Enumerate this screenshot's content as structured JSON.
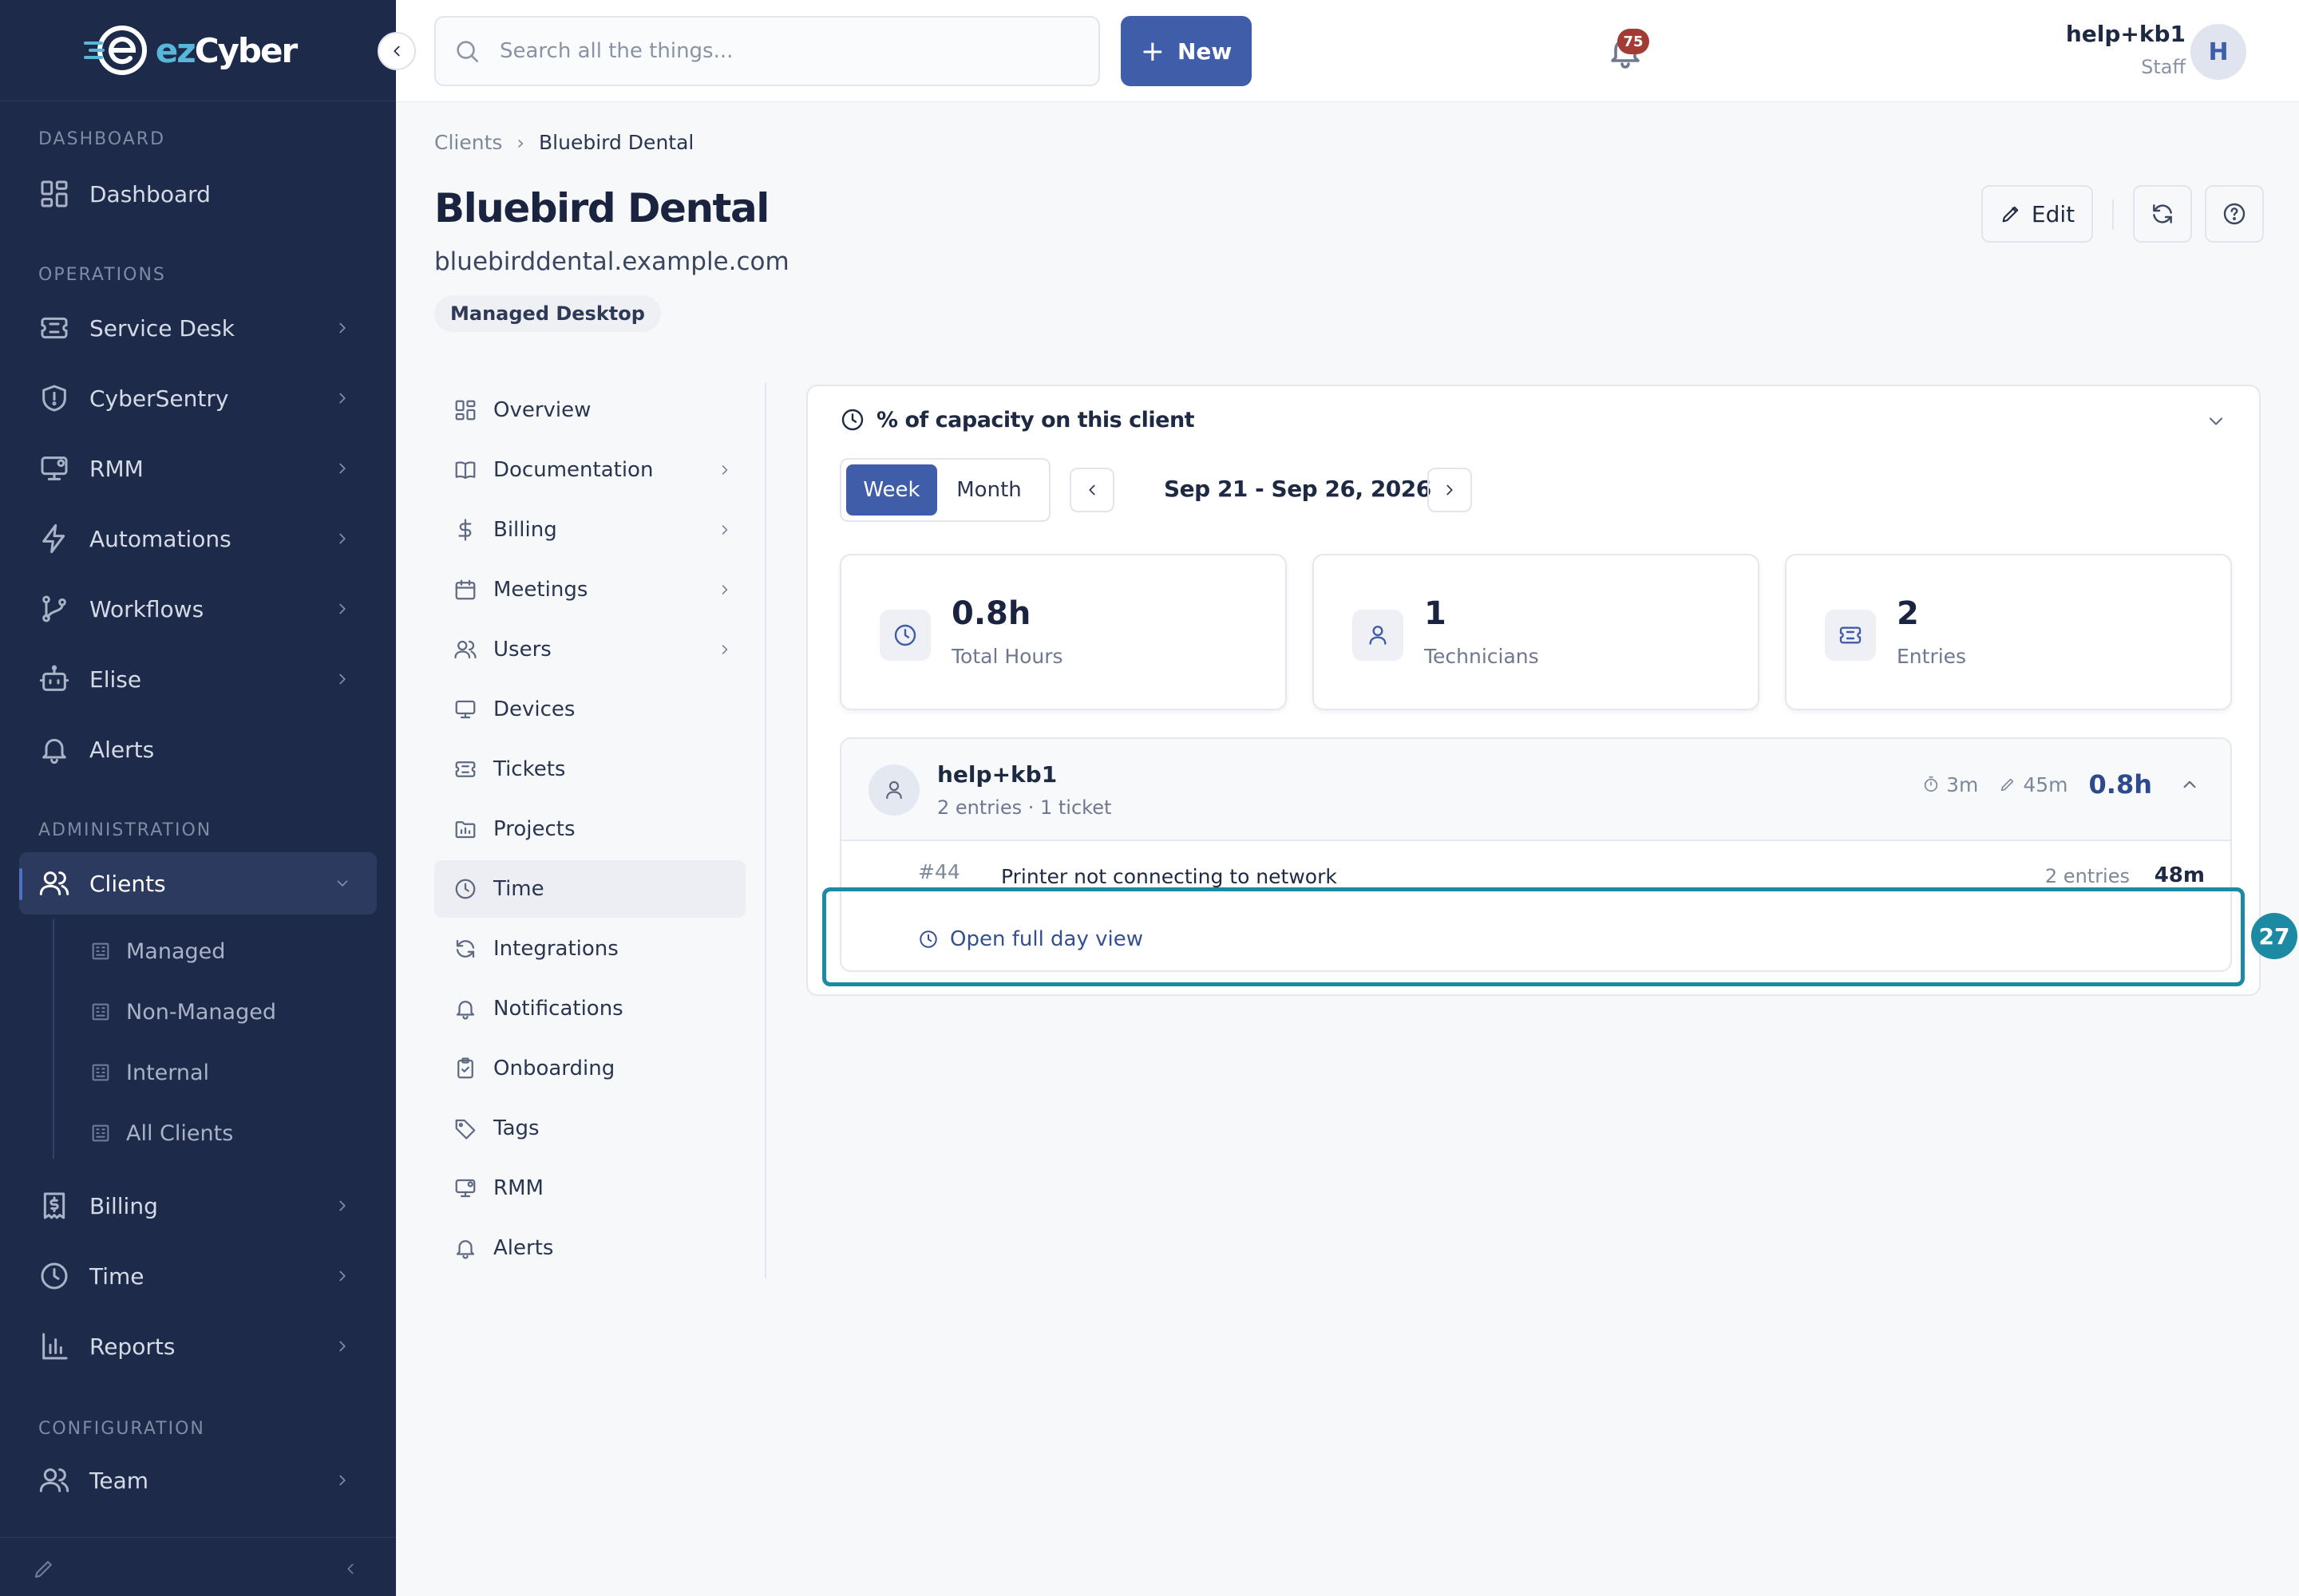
{
  "brand": {
    "name_prefix": "ez",
    "name_suffix": "Cyber"
  },
  "sidebar": {
    "sections": {
      "dashboard": "DASHBOARD",
      "operations": "OPERATIONS",
      "administration": "ADMINISTRATION",
      "configuration": "CONFIGURATION"
    },
    "items": {
      "dashboard": "Dashboard",
      "service_desk": "Service Desk",
      "cybersentry": "CyberSentry",
      "rmm": "RMM",
      "automations": "Automations",
      "workflows": "Workflows",
      "elise": "Elise",
      "alerts": "Alerts",
      "clients": "Clients",
      "billing": "Billing",
      "time": "Time",
      "reports": "Reports",
      "team": "Team"
    },
    "client_subitems": [
      "Managed",
      "Non-Managed",
      "Internal",
      "All Clients"
    ],
    "active_item": "Clients"
  },
  "topbar": {
    "search_placeholder": "Search all the things...",
    "new_label": "New",
    "notification_count": "75",
    "user_name": "help+kb1",
    "user_role": "Staff",
    "avatar_initial": "H"
  },
  "page": {
    "breadcrumb_root": "Clients",
    "breadcrumb_current": "Bluebird Dental",
    "title": "Bluebird Dental",
    "domain": "bluebirddental.example.com",
    "tag": "Managed Desktop",
    "edit_label": "Edit"
  },
  "subnav": {
    "items": [
      "Overview",
      "Documentation",
      "Billing",
      "Meetings",
      "Users",
      "Devices",
      "Tickets",
      "Projects",
      "Time",
      "Integrations",
      "Notifications",
      "Onboarding",
      "Tags",
      "RMM",
      "Alerts"
    ],
    "active": "Time"
  },
  "capacity": {
    "heading": "% of capacity on this client",
    "toggle": {
      "week": "Week",
      "month": "Month",
      "selected": "Week"
    },
    "date_range": "Sep 21 - Sep 26, 2026",
    "stats": [
      {
        "value": "0.8h",
        "label": "Total Hours",
        "icon": "clock-icon"
      },
      {
        "value": "1",
        "label": "Technicians",
        "icon": "user-icon"
      },
      {
        "value": "2",
        "label": "Entries",
        "icon": "ticket-icon"
      }
    ],
    "technician": {
      "name": "help+kb1",
      "summary": "2 entries · 1 ticket",
      "timer": "3m",
      "manual": "45m",
      "total": "0.8h"
    },
    "ticket": {
      "id": "#44",
      "title": "Printer not connecting to network",
      "entries": "2 entries",
      "duration": "48m"
    },
    "full_day_link": "Open full day view"
  },
  "highlight": {
    "badge": "27"
  },
  "colors": {
    "sidebar_bg": "#1e2a4a",
    "primary": "#3f5da8",
    "highlight": "#1d8aa3",
    "badge_red": "#a33b35"
  }
}
